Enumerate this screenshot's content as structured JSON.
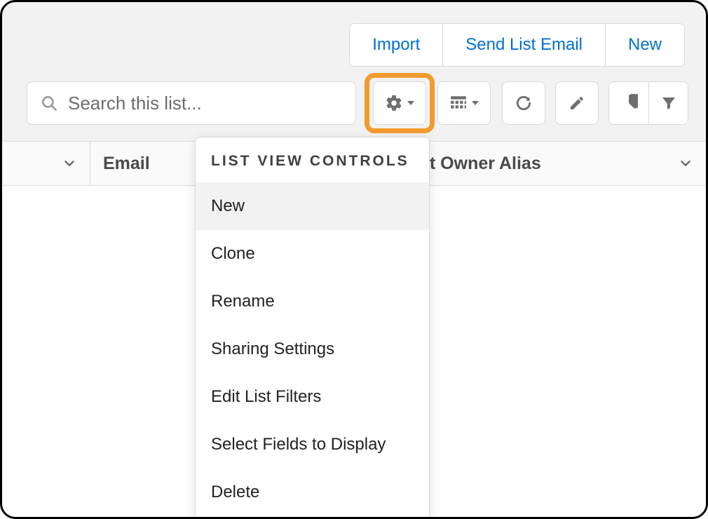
{
  "topActions": {
    "import": "Import",
    "sendListEmail": "Send List Email",
    "new": "New"
  },
  "search": {
    "placeholder": "Search this list..."
  },
  "columns": {
    "col1": "Email",
    "col2": "ct Owner Alias"
  },
  "menu": {
    "title": "LIST VIEW CONTROLS",
    "items": [
      "New",
      "Clone",
      "Rename",
      "Sharing Settings",
      "Edit List Filters",
      "Select Fields to Display",
      "Delete"
    ],
    "activeIndex": 0
  }
}
